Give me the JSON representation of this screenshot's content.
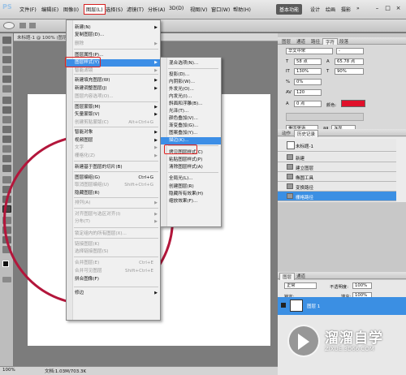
{
  "app": {
    "logo": "PS",
    "title": "未标题-1 @ 100% (图层1, RGB/8)"
  },
  "menubar": {
    "items": [
      "文件(F)",
      "编辑(E)",
      "图像(I)",
      "图层(L)",
      "选择(S)",
      "滤镜(T)",
      "分析(A)",
      "3D(D)",
      "视图(V)",
      "窗口(W)",
      "帮助(H)"
    ],
    "workspaces": [
      "基本功能",
      "设计",
      "绘画",
      "摄影",
      "»"
    ],
    "win": [
      "–",
      "□",
      "×"
    ]
  },
  "status": {
    "zoom": "100%",
    "doc": "文档:1.03M/703.3K"
  },
  "layer_menu": {
    "items": [
      {
        "label": "新建(N)",
        "sc": "",
        "arrow": true,
        "dis": false
      },
      {
        "label": "复制图层(D)...",
        "sc": "",
        "arrow": false,
        "dis": false
      },
      {
        "label": "删除",
        "sc": "",
        "arrow": true,
        "dis": true
      },
      {
        "label": "图层属性(P)...",
        "sc": "",
        "arrow": false,
        "dis": false
      },
      {
        "label": "图层样式(Y)",
        "sc": "",
        "arrow": true,
        "dis": false
      },
      {
        "label": "智能滤镜",
        "sc": "",
        "arrow": true,
        "dis": true
      },
      {
        "label": "新建填充图层(W)",
        "sc": "",
        "arrow": true,
        "dis": false
      },
      {
        "label": "新建调整图层(J)",
        "sc": "",
        "arrow": true,
        "dis": false
      },
      {
        "label": "图层内容选项(O)...",
        "sc": "",
        "arrow": false,
        "dis": true
      },
      {
        "label": "图层蒙版(M)",
        "sc": "",
        "arrow": true,
        "dis": false
      },
      {
        "label": "矢量蒙版(V)",
        "sc": "",
        "arrow": true,
        "dis": false
      },
      {
        "label": "创建剪贴蒙版(C)",
        "sc": "Alt+Ctrl+G",
        "arrow": false,
        "dis": true
      },
      {
        "label": "智能对象",
        "sc": "",
        "arrow": true,
        "dis": false
      },
      {
        "label": "视频图层",
        "sc": "",
        "arrow": true,
        "dis": false
      },
      {
        "label": "文字",
        "sc": "",
        "arrow": true,
        "dis": true
      },
      {
        "label": "栅格化(Z)",
        "sc": "",
        "arrow": true,
        "dis": true
      },
      {
        "label": "新建基于图层的切片(B)",
        "sc": "",
        "arrow": false,
        "dis": false
      },
      {
        "label": "图层编组(G)",
        "sc": "Ctrl+G",
        "arrow": false,
        "dis": false
      },
      {
        "label": "取消图层编组(U)",
        "sc": "Shift+Ctrl+G",
        "arrow": false,
        "dis": true
      },
      {
        "label": "隐藏图层(R)",
        "sc": "",
        "arrow": false,
        "dis": false
      },
      {
        "label": "排列(A)",
        "sc": "",
        "arrow": true,
        "dis": true
      },
      {
        "label": "对齐图层与选区对齐(I)",
        "sc": "",
        "arrow": true,
        "dis": true
      },
      {
        "label": "分布(T)",
        "sc": "",
        "arrow": true,
        "dis": true
      },
      {
        "label": "锁定组内的所有图层(X)...",
        "sc": "",
        "arrow": false,
        "dis": true
      },
      {
        "label": "链接图层(K)",
        "sc": "",
        "arrow": false,
        "dis": true
      },
      {
        "label": "选择链接图层(S)",
        "sc": "",
        "arrow": false,
        "dis": true
      },
      {
        "label": "合并图层(E)",
        "sc": "Ctrl+E",
        "arrow": false,
        "dis": true
      },
      {
        "label": "合并可见图层",
        "sc": "Shift+Ctrl+E",
        "arrow": false,
        "dis": true
      },
      {
        "label": "拼合图像(F)",
        "sc": "",
        "arrow": false,
        "dis": false
      },
      {
        "label": "修边",
        "sc": "",
        "arrow": true,
        "dis": false
      }
    ]
  },
  "style_menu": {
    "items": [
      "混合选项(N)...",
      "投影(D)...",
      "内阴影(W)...",
      "外发光(O)...",
      "内发光(I)...",
      "斜面和浮雕(B)...",
      "光泽(T)...",
      "颜色叠加(V)...",
      "渐变叠加(G)...",
      "图案叠加(Y)...",
      "描边(K)...",
      "拷贝图层样式(C)",
      "粘贴图层样式(P)",
      "清除图层样式(A)",
      "全局光(L)...",
      "创建图层(R)",
      "隐藏所有效果(H)",
      "缩放效果(F)..."
    ]
  },
  "character": {
    "tabs": [
      "图层",
      "通道",
      "路径",
      "字符",
      "段落"
    ],
    "font": "华文中宋",
    "style": "-",
    "size": "58 点",
    "leading": "65.78 点",
    "tracking": "130%",
    "scale": "90%",
    "baseline": "0%",
    "kerning": "120",
    "shift": "0 点",
    "color_label": "颜色:",
    "lang": "美国英语",
    "aa": "浑厚",
    "aa_prefix": "aa",
    "color": "#e0102a"
  },
  "history": {
    "tabs": [
      "历史记录",
      "动作"
    ],
    "doc": "未标题-1",
    "rows": [
      "新建",
      "建立图层",
      "椭圆工具",
      "变换路径",
      "栅格路径"
    ]
  },
  "layers": {
    "tabs": [
      "图层",
      "通道"
    ],
    "mode": "正常",
    "opacity_label": "不透明度:",
    "opacity": "100%",
    "fill_label": "填充:",
    "fill": "100%",
    "lock_label": "锁定:",
    "layer": "图层 1"
  },
  "watermark": {
    "title": "溜溜自学",
    "sub": "ZIXUE.3D66.COM"
  }
}
